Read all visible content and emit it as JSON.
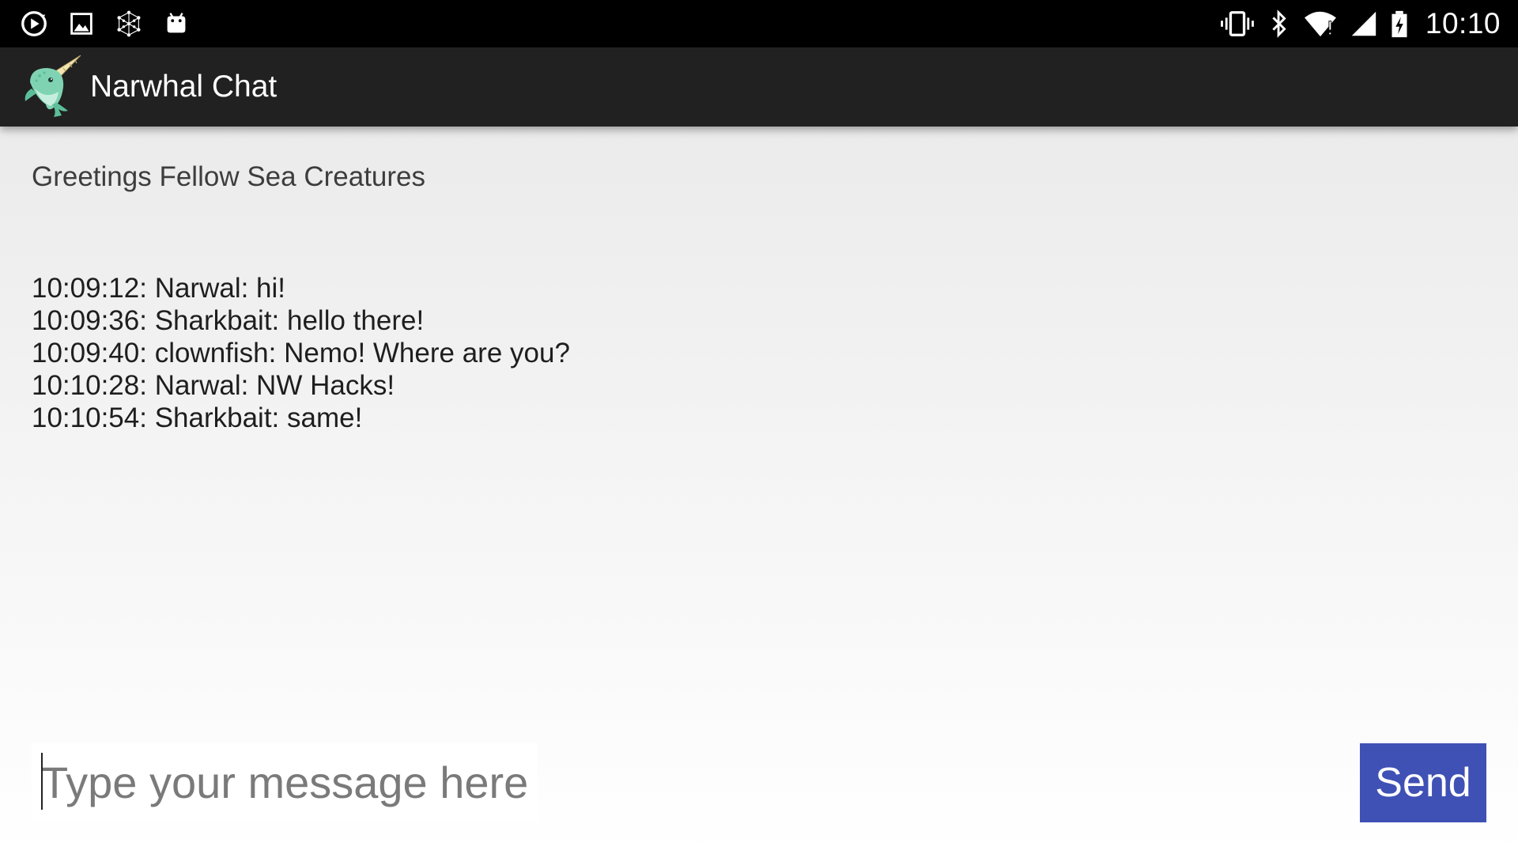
{
  "status_bar": {
    "time": "10:10",
    "icons_left": [
      "play-sync-icon",
      "gallery-icon",
      "network-icon",
      "android-icon"
    ],
    "icons_right": [
      "vibrate-icon",
      "bluetooth-icon",
      "wifi-alert-icon",
      "signal-icon",
      "battery-charging-icon"
    ]
  },
  "app_bar": {
    "title": "Narwhal Chat",
    "logo": "narwhal-logo",
    "background": "#212121"
  },
  "chat": {
    "greeting": "Greetings Fellow Sea Creatures",
    "messages": [
      "10:09:12: Narwal: hi!",
      "10:09:36: Sharkbait: hello there!",
      "10:09:40: clownfish: Nemo! Where are you?",
      "10:10:28: Narwal: NW Hacks!",
      "10:10:54: Sharkbait: same!"
    ]
  },
  "composer": {
    "placeholder": "Type your message here!",
    "value": "",
    "send_label": "Send"
  },
  "colors": {
    "accent": "#3f51b5",
    "status_bar": "#000000"
  }
}
